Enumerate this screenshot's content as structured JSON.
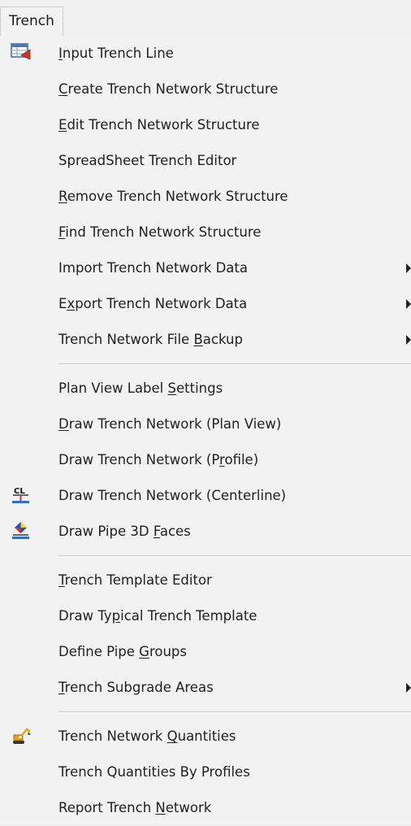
{
  "menubar": {
    "title": "Trench"
  },
  "items": [
    {
      "label": "Input Trench Line",
      "mn": 0,
      "icon": "trench-line-icon"
    },
    {
      "label": "Create Trench Network Structure",
      "mn": 0
    },
    {
      "label": "Edit Trench Network Structure",
      "mn": 0
    },
    {
      "label": "SpreadSheet Trench Editor",
      "mn": -1
    },
    {
      "label": "Remove Trench Network Structure",
      "mn": 0
    },
    {
      "label": "Find Trench Network Structure",
      "mn": 0
    },
    {
      "label": "Import Trench Network Data",
      "mn": -1,
      "submenu": true
    },
    {
      "label": "Export Trench Network Data",
      "mn": 1,
      "submenu": true
    },
    {
      "label": "Trench Network File Backup",
      "mn": 20,
      "submenu": true
    },
    {
      "separator": true
    },
    {
      "label": "Plan View Label Settings",
      "mn": 16
    },
    {
      "label": "Draw Trench Network (Plan View)",
      "mn": 0
    },
    {
      "label": "Draw Trench Network (Profile)",
      "mn": 22
    },
    {
      "label": "Draw Trench Network (Centerline)",
      "mn": -1,
      "icon": "centerline-icon"
    },
    {
      "label": "Draw Pipe 3D Faces",
      "mn": 13,
      "icon": "pipe-3d-icon"
    },
    {
      "separator": true
    },
    {
      "label": "Trench Template Editor",
      "mn": 0
    },
    {
      "label": "Draw Typical Trench Template",
      "mn": 7
    },
    {
      "label": "Define Pipe Groups",
      "mn": 12
    },
    {
      "label": "Trench Subgrade Areas",
      "mn": 0,
      "submenu": true
    },
    {
      "separator": true
    },
    {
      "label": "Trench Network Quantities",
      "mn": 15,
      "icon": "excavator-icon"
    },
    {
      "label": "Trench Quantities By Profiles",
      "mn": -1
    },
    {
      "label": "Report Trench Network",
      "mn": 14
    }
  ]
}
